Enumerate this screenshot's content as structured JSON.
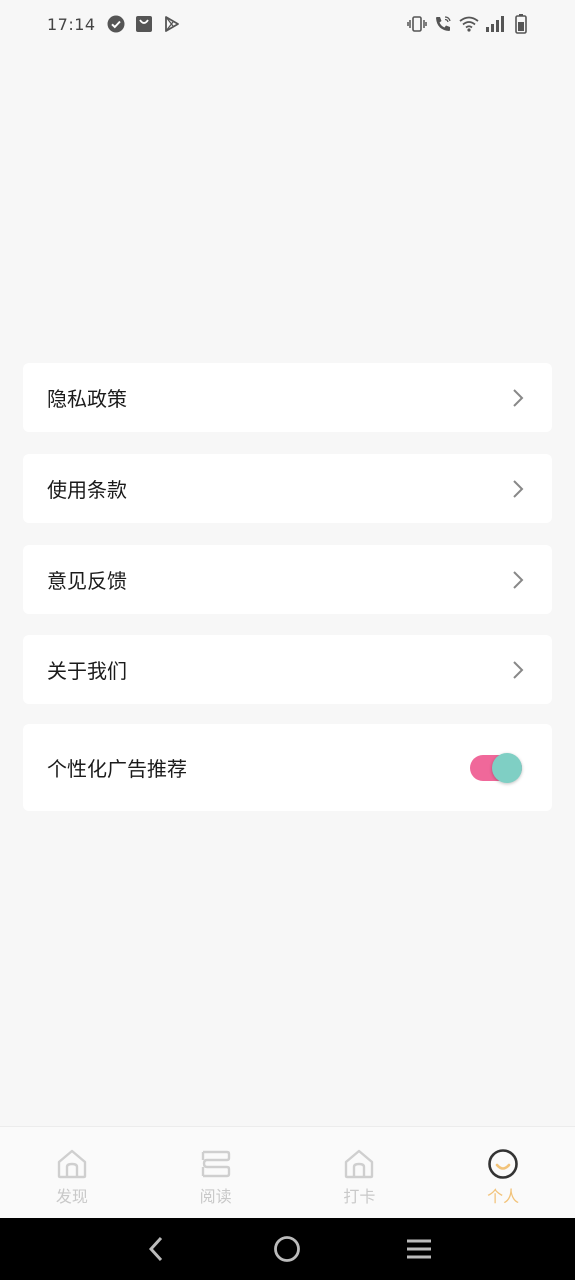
{
  "status_bar": {
    "time": "17:14",
    "left_icons": [
      "check-circle-icon",
      "shopping-bag-icon",
      "play-store-icon"
    ],
    "right_icons": [
      "vibrate-icon",
      "wifi-call-icon",
      "wifi-icon",
      "signal-icon",
      "battery-icon"
    ]
  },
  "settings": {
    "items": [
      {
        "label": "隐私政策",
        "control": "chevron"
      },
      {
        "label": "使用条款",
        "control": "chevron"
      },
      {
        "label": "意见反馈",
        "control": "chevron"
      },
      {
        "label": "关于我们",
        "control": "chevron"
      },
      {
        "label": "个性化广告推荐",
        "control": "toggle",
        "toggle_on": true
      }
    ]
  },
  "tab_bar": {
    "tabs": [
      {
        "label": "发现",
        "icon": "home-icon",
        "active": false
      },
      {
        "label": "阅读",
        "icon": "book-icon",
        "active": false
      },
      {
        "label": "打卡",
        "icon": "checkin-icon",
        "active": false
      },
      {
        "label": "个人",
        "icon": "profile-icon",
        "active": true
      }
    ]
  },
  "colors": {
    "accent": "#f2c37a",
    "toggle_track": "#f0689a",
    "toggle_knob": "#7fcfc4",
    "background": "#f7f7f7"
  },
  "nav_bar": {
    "buttons": [
      "back-icon",
      "home-circle-icon",
      "menu-icon"
    ]
  }
}
